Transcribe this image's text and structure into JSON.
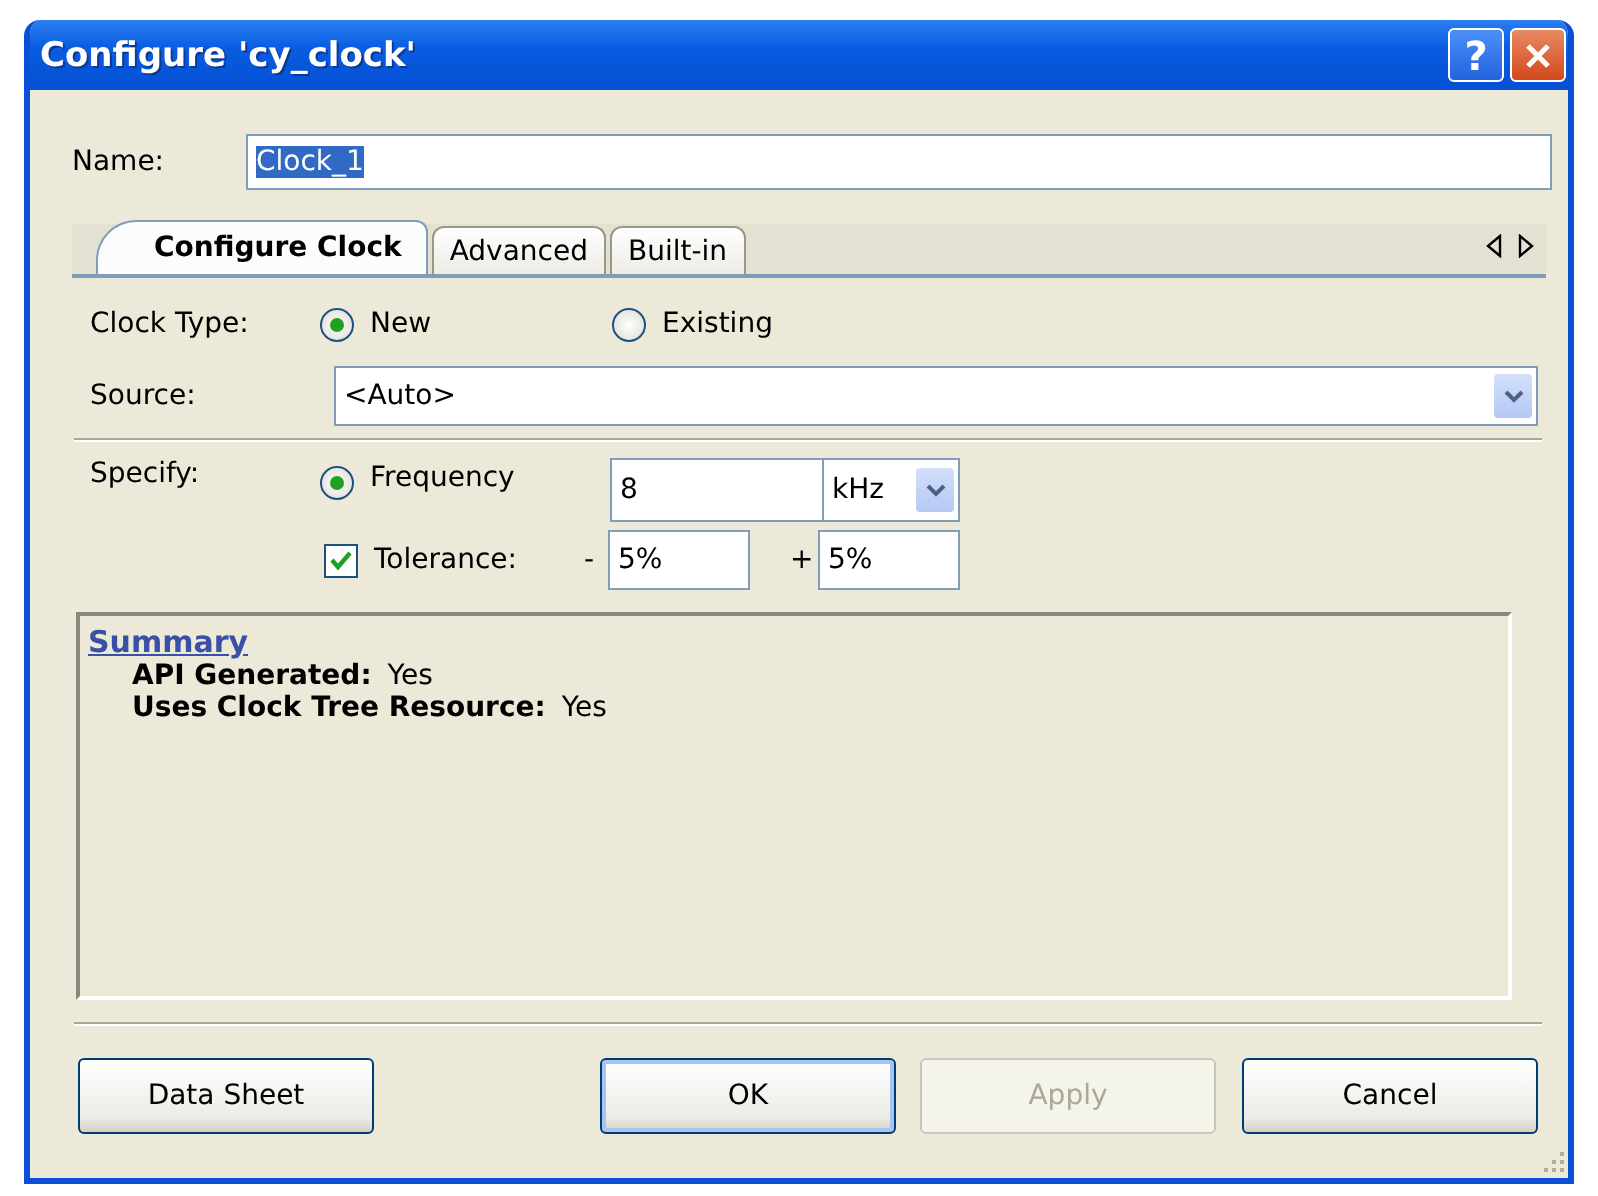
{
  "window": {
    "title": "Configure 'cy_clock'",
    "help": "?"
  },
  "name": {
    "label": "Name:",
    "value": "Clock_1",
    "text_selected": true
  },
  "tabs": [
    {
      "label": "Configure Clock",
      "selected": true
    },
    {
      "label": "Advanced",
      "selected": false
    },
    {
      "label": "Built-in",
      "selected": false
    }
  ],
  "clock_type": {
    "label": "Clock Type:",
    "options": [
      {
        "label": "New",
        "selected": true
      },
      {
        "label": "Existing",
        "selected": false
      }
    ]
  },
  "source": {
    "label": "Source:",
    "value": "<Auto>"
  },
  "specify": {
    "label": "Specify:",
    "frequency": {
      "label": "Frequency",
      "selected": true,
      "value": "8",
      "unit": "kHz"
    },
    "tolerance": {
      "label": "Tolerance:",
      "checked": true,
      "minus_sign": "-",
      "minus": "5%",
      "plus_sign": "+",
      "plus": "5%"
    }
  },
  "summary": {
    "title": "Summary",
    "items": [
      {
        "label": "API Generated:",
        "value": "Yes"
      },
      {
        "label": "Uses Clock Tree Resource:",
        "value": "Yes"
      }
    ]
  },
  "buttons": [
    {
      "label": "Data Sheet",
      "default": false,
      "disabled": false
    },
    {
      "label": "OK",
      "default": true,
      "disabled": false
    },
    {
      "label": "Apply",
      "default": false,
      "disabled": true
    },
    {
      "label": "Cancel",
      "default": false,
      "disabled": false
    }
  ]
}
